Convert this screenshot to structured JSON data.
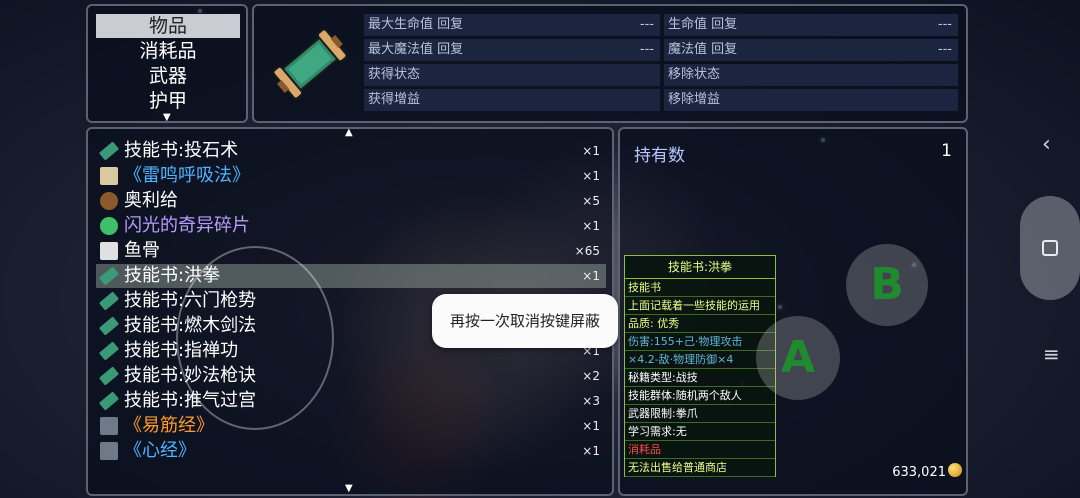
{
  "categories": {
    "items": [
      {
        "label": "物品",
        "selected": true
      },
      {
        "label": "消耗品",
        "selected": false
      },
      {
        "label": "武器",
        "selected": false
      },
      {
        "label": "护甲",
        "selected": false
      }
    ]
  },
  "effects": {
    "left": [
      {
        "label": "最大生命值 回复",
        "value": "---"
      },
      {
        "label": "最大魔法值 回复",
        "value": "---"
      },
      {
        "label": "获得状态",
        "value": ""
      },
      {
        "label": "获得增益",
        "value": ""
      }
    ],
    "right": [
      {
        "label": "生命值 回复",
        "value": "---"
      },
      {
        "label": "魔法值 回复",
        "value": "---"
      },
      {
        "label": "移除状态",
        "value": ""
      },
      {
        "label": "移除增益",
        "value": ""
      }
    ]
  },
  "inventory": {
    "items": [
      {
        "name": "技能书:投石术",
        "count": "×1",
        "color": "#ffffff",
        "icon": "scroll-icon"
      },
      {
        "name": "《雷鸣呼吸法》",
        "count": "×1",
        "color": "#4fb3ff",
        "icon": "paper-icon"
      },
      {
        "name": "奥利给",
        "count": "×5",
        "color": "#ffffff",
        "icon": "poop-icon"
      },
      {
        "name": "闪光的奇异碎片",
        "count": "×1",
        "color": "#b69cff",
        "icon": "crystal-icon"
      },
      {
        "name": "鱼骨",
        "count": "×65",
        "color": "#ffffff",
        "icon": "fishbone-icon"
      },
      {
        "name": "技能书:洪拳",
        "count": "×1",
        "color": "#ffffff",
        "icon": "scroll-icon",
        "selected": true
      },
      {
        "name": "技能书:六门枪势",
        "count": "",
        "color": "#ffffff",
        "icon": "scroll-icon"
      },
      {
        "name": "技能书:燃木剑法",
        "count": "",
        "color": "#ffffff",
        "icon": "scroll-icon"
      },
      {
        "name": "技能书:指禅功",
        "count": "×1",
        "color": "#ffffff",
        "icon": "scroll-icon"
      },
      {
        "name": "技能书:妙法枪诀",
        "count": "×2",
        "color": "#ffffff",
        "icon": "scroll-icon"
      },
      {
        "name": "技能书:推气过宫",
        "count": "×3",
        "color": "#ffffff",
        "icon": "scroll-icon"
      },
      {
        "name": "《易筋经》",
        "count": "×1",
        "color": "#ff9a2a",
        "icon": "book-icon"
      },
      {
        "name": "《心经》",
        "count": "×1",
        "color": "#4fb3ff",
        "icon": "book-icon"
      }
    ]
  },
  "holding": {
    "label": "持有数",
    "value": "1"
  },
  "gold": {
    "amount": "633,021"
  },
  "tooltip": {
    "title": "技能书:洪拳",
    "lines": [
      {
        "text": "技能书",
        "color": "#e9ff8a"
      },
      {
        "text": "上面记载着一些技能的运用",
        "color": "#e9ff8a"
      },
      {
        "text": "品质: 优秀",
        "color": "#e9ff8a"
      },
      {
        "text": "伤害:155+己·物理攻击",
        "color": "#5fb6d8"
      },
      {
        "text": "×4.2-敌·物理防御×4",
        "color": "#5fb6d8"
      },
      {
        "text": "秘籍类型:战技",
        "color": "#ffffff"
      },
      {
        "text": "技能群体:随机两个敌人",
        "color": "#ffffff"
      },
      {
        "text": "武器限制:拳爪",
        "color": "#ffffff"
      },
      {
        "text": "学习需求:无",
        "color": "#ffffff"
      },
      {
        "text": "消耗品",
        "color": "#ff4a4a"
      },
      {
        "text": "无法出售给普通商店",
        "color": "#e9ff8a"
      }
    ]
  },
  "toast": {
    "text": "再按一次取消按键屏蔽"
  },
  "controls": {
    "a_label": "A",
    "b_label": "B"
  }
}
